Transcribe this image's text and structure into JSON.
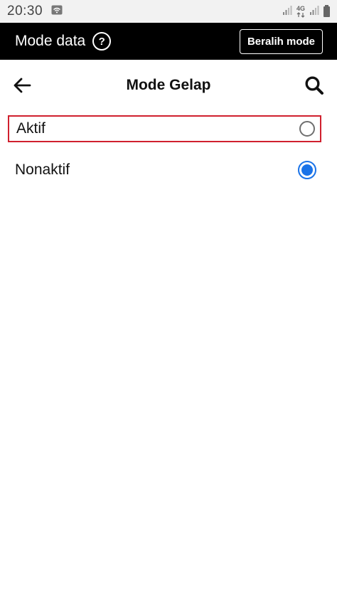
{
  "status_bar": {
    "time": "20:30",
    "network": "4G"
  },
  "data_bar": {
    "title": "Mode data",
    "help_glyph": "?",
    "switch_label": "Beralih mode"
  },
  "header": {
    "title": "Mode Gelap"
  },
  "options": [
    {
      "label": "Aktif",
      "selected": false
    },
    {
      "label": "Nonaktif",
      "selected": true
    }
  ],
  "colors": {
    "accent": "#1a73e8",
    "highlight_border": "#d0202e"
  }
}
